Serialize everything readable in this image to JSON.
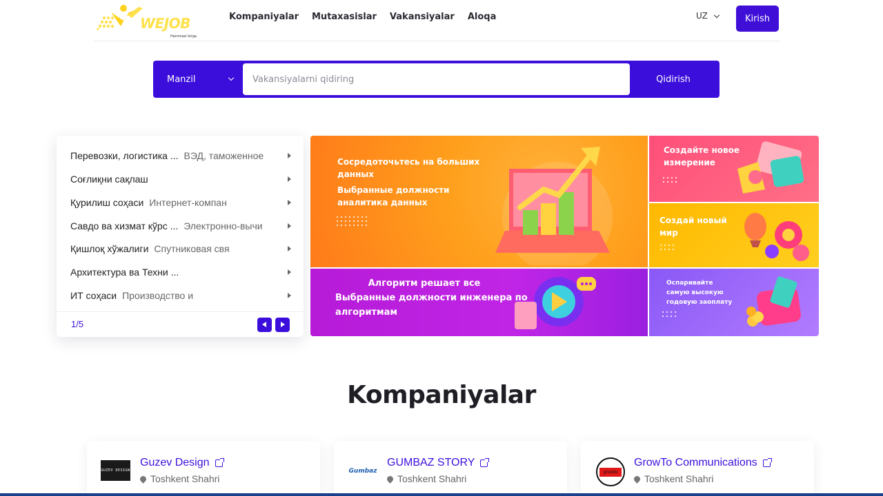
{
  "header": {
    "logo_text": "WEJOB",
    "logo_tagline": "Hammasi birga",
    "nav": [
      "Kompaniyalar",
      "Mutaxasislar",
      "Vakansiyalar",
      "Aloqa"
    ],
    "lang": "UZ",
    "login_label": "Kirish",
    "brand_color": "#3c0edc",
    "logo_color": "#ffe14d"
  },
  "search": {
    "location_label": "Manzil",
    "placeholder": "Vakansiyalarni qidiring",
    "button_label": "Qidirish"
  },
  "categories": {
    "items": [
      {
        "main": "Перевозки, логистика ...",
        "sub": "ВЭД, таможенное"
      },
      {
        "main": "Соғлиқни сақлаш",
        "sub": ""
      },
      {
        "main": "Қурилиш соҳаси",
        "sub": "Интернет-компан"
      },
      {
        "main": "Савдо ва хизмат кўрс ...",
        "sub": "Электронно-вычи"
      },
      {
        "main": "Қишлоқ хўжалиги",
        "sub": "Спутниковая свя"
      },
      {
        "main": "Архитектура ва Техни ...",
        "sub": ""
      },
      {
        "main": "ИТ соҳаси",
        "sub": "Производство и"
      }
    ],
    "page": "1/5"
  },
  "banners": {
    "b1": {
      "line1": "Сосредоточьтесь на больших",
      "line2": "данных",
      "line3": "Выбранные должности",
      "line4": "аналитика данных"
    },
    "b2": {
      "line1": "Создайте новое",
      "line2": "измерение"
    },
    "b3": {
      "line1": "Создай новый",
      "line2": "мир"
    },
    "b4": {
      "line1": "Алгоритм решает все",
      "line2": "Выбранные должности инженера по",
      "line3": "алгоритмам"
    },
    "b5": {
      "line1": "Оспаривайте",
      "line2": "самую высокую",
      "line3": "годовую заоплату"
    }
  },
  "companies": {
    "title": "Kompaniyalar",
    "items": [
      {
        "name": "Guzev Design",
        "city": "Toshkent Shahri",
        "logo_text": "GUZEV DESIGN"
      },
      {
        "name": "GUMBAZ STORY",
        "city": "Toshkent Shahri",
        "logo_text": "Gumbaz"
      },
      {
        "name": "GrowTo Communications",
        "city": "Toshkent Shahri",
        "logo_text": "growto"
      }
    ]
  }
}
